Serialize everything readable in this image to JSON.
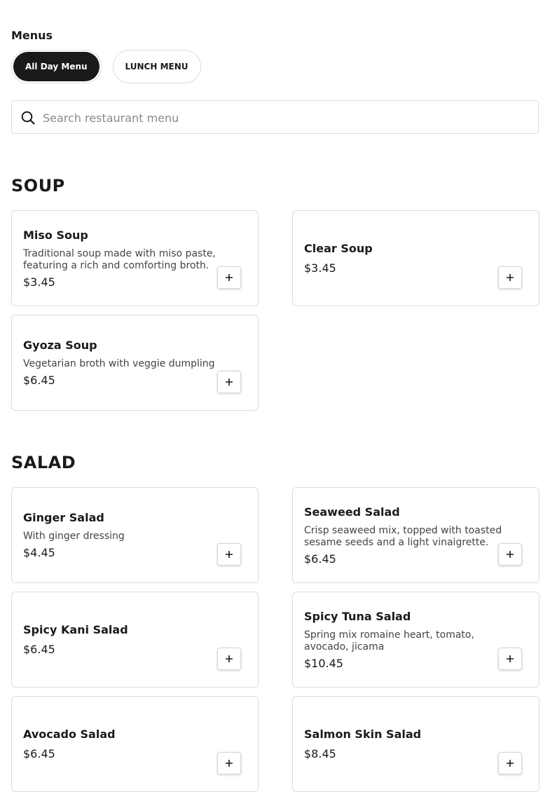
{
  "header": {
    "menus_label": "Menus"
  },
  "tabs": [
    {
      "label": "All Day Menu",
      "active": true
    },
    {
      "label": "LUNCH MENU",
      "active": false
    }
  ],
  "search": {
    "placeholder": "Search restaurant menu",
    "icon": "search-icon"
  },
  "sections": [
    {
      "title": "SOUP",
      "items": [
        {
          "name": "Miso Soup",
          "description": "Traditional soup made with miso paste, featuring a rich and comforting broth.",
          "price": "$3.45"
        },
        {
          "name": "Clear Soup",
          "description": "",
          "price": "$3.45"
        },
        {
          "name": "Gyoza Soup",
          "description": "Vegetarian broth with veggie dumpling",
          "price": "$6.45"
        }
      ]
    },
    {
      "title": "SALAD",
      "items": [
        {
          "name": "Ginger Salad",
          "description": "With ginger dressing",
          "price": "$4.45"
        },
        {
          "name": "Seaweed Salad",
          "description": "Crisp seaweed mix, topped with toasted sesame seeds and a light vinaigrette.",
          "price": "$6.45"
        },
        {
          "name": "Spicy Kani Salad",
          "description": "",
          "price": "$6.45"
        },
        {
          "name": "Spicy Tuna Salad",
          "description": "Spring mix romaine heart, tomato, avocado, jicama",
          "price": "$10.45"
        },
        {
          "name": "Avocado Salad",
          "description": "",
          "price": "$6.45"
        },
        {
          "name": "Salmon Skin Salad",
          "description": "",
          "price": "$8.45"
        }
      ]
    }
  ],
  "add_icon": "plus-icon"
}
